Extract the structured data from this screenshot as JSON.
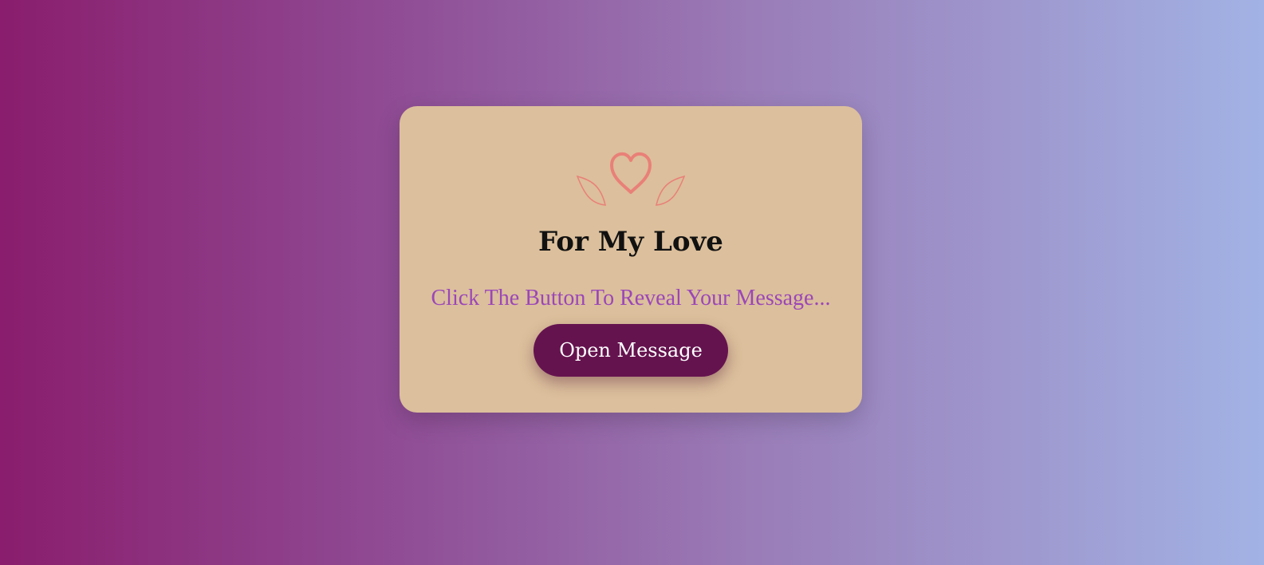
{
  "card": {
    "title": "For My Love",
    "subtitle": "Click The Button To Reveal Your Message...",
    "button_label": "Open Message"
  },
  "icons": {
    "heart": "heart-icon",
    "left_wing": "wing-icon",
    "right_wing": "wing-icon"
  },
  "colors": {
    "card_background": "#dcbf9c",
    "heart": "#e98078",
    "title": "#111111",
    "subtitle": "#9b47b8",
    "button_background": "#65134f",
    "button_text": "#ffffff"
  }
}
